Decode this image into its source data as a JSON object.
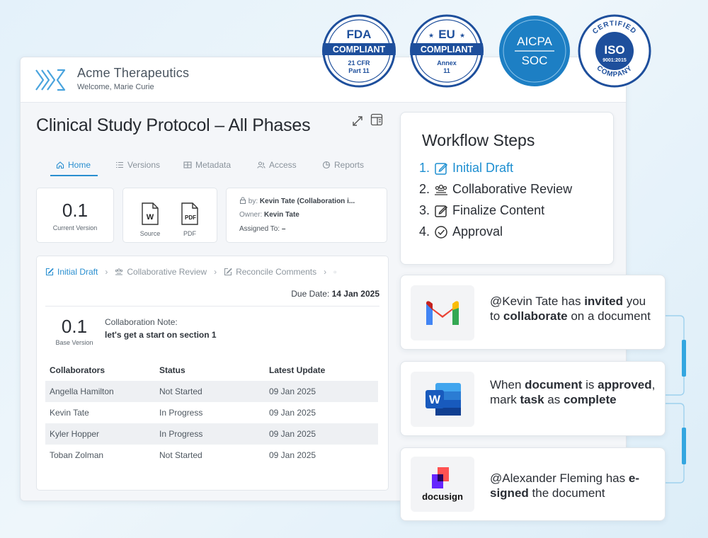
{
  "app": {
    "company": "Acme Therapeutics",
    "welcome": "Welcome, Marie Curie",
    "page_title": "Clinical Study Protocol – All Phases",
    "tabs": [
      {
        "label": "Home",
        "icon": "home-icon"
      },
      {
        "label": "Versions",
        "icon": "list-icon"
      },
      {
        "label": "Metadata",
        "icon": "table-icon"
      },
      {
        "label": "Access",
        "icon": "users-icon"
      },
      {
        "label": "Reports",
        "icon": "chart-icon"
      }
    ],
    "version_card": {
      "value": "0.1",
      "caption": "Current Version"
    },
    "files": [
      {
        "label": "Source",
        "glyph": "W"
      },
      {
        "label": "PDF",
        "glyph": "PDF"
      }
    ],
    "meta": {
      "locked_by_prefix": "by:",
      "locked_by": "Kevin Tate (Collaboration i...",
      "owner_label": "Owner:",
      "owner": "Kevin Tate",
      "assigned_label": "Assigned To:",
      "assigned": "–"
    },
    "workflow_bar": [
      {
        "label": "Initial Draft",
        "active": true
      },
      {
        "label": "Collaborative Review",
        "active": false
      },
      {
        "label": "Reconcile Comments",
        "active": false
      }
    ],
    "due_label": "Due Date:",
    "due_value": "14 Jan 2025",
    "base_version": {
      "value": "0.1",
      "caption": "Base Version"
    },
    "collab_note_label": "Collaboration Note:",
    "collab_note_text": "let's get a start on section 1",
    "table": {
      "headers": [
        "Collaborators",
        "Status",
        "Latest Update"
      ],
      "rows": [
        [
          "Angella Hamilton",
          "Not Started",
          "09 Jan 2025"
        ],
        [
          "Kevin Tate",
          "In Progress",
          "09 Jan 2025"
        ],
        [
          "Kyler Hopper",
          "In Progress",
          "09 Jan 2025"
        ],
        [
          "Toban Zolman",
          "Not Started",
          "09 Jan 2025"
        ]
      ]
    }
  },
  "badges": [
    {
      "top": "FDA",
      "band": "COMPLIANT",
      "line1": "21 CFR",
      "line2": "Part 11"
    },
    {
      "top": "EU",
      "band": "COMPLIANT",
      "line1": "Annex",
      "line2": "11"
    },
    {
      "line1": "AICPA",
      "line2": "SOC"
    },
    {
      "arc_top": "CERTIFIED",
      "main": "ISO",
      "sub": "9001:2015",
      "arc_bottom": "COMPANY"
    }
  ],
  "workflow_steps": {
    "title": "Workflow Steps",
    "items": [
      {
        "num": "1.",
        "label": "Initial Draft",
        "icon": "edit-icon",
        "active": true
      },
      {
        "num": "2.",
        "label": "Collaborative Review",
        "icon": "users-icon",
        "active": false
      },
      {
        "num": "3.",
        "label": "Finalize Content",
        "icon": "edit-icon",
        "active": false
      },
      {
        "num": "4.",
        "label": "Approval",
        "icon": "check-circle-icon",
        "active": false
      }
    ]
  },
  "notifications": [
    {
      "icon": "gmail-icon",
      "parts": [
        [
          "@Kevin Tate has ",
          false
        ],
        [
          "invited",
          true
        ],
        [
          " you to ",
          false
        ],
        [
          "collaborate",
          true
        ],
        [
          " on a document",
          false
        ]
      ]
    },
    {
      "icon": "word-icon",
      "parts": [
        [
          "When ",
          false
        ],
        [
          "document",
          true
        ],
        [
          " is ",
          false
        ],
        [
          "approved",
          true
        ],
        [
          ", mark ",
          false
        ],
        [
          "task",
          true
        ],
        [
          " as ",
          false
        ],
        [
          "complete",
          true
        ]
      ]
    },
    {
      "icon": "docusign-icon",
      "logo_text": "docusign",
      "parts": [
        [
          "@Alexander Fleming has ",
          false
        ],
        [
          "e-signed",
          true
        ],
        [
          " the document",
          false
        ]
      ]
    }
  ],
  "colors": {
    "accent": "#2a8fd0",
    "badge_blue": "#1e4f9c",
    "aicpa_blue": "#1d7fc4"
  }
}
